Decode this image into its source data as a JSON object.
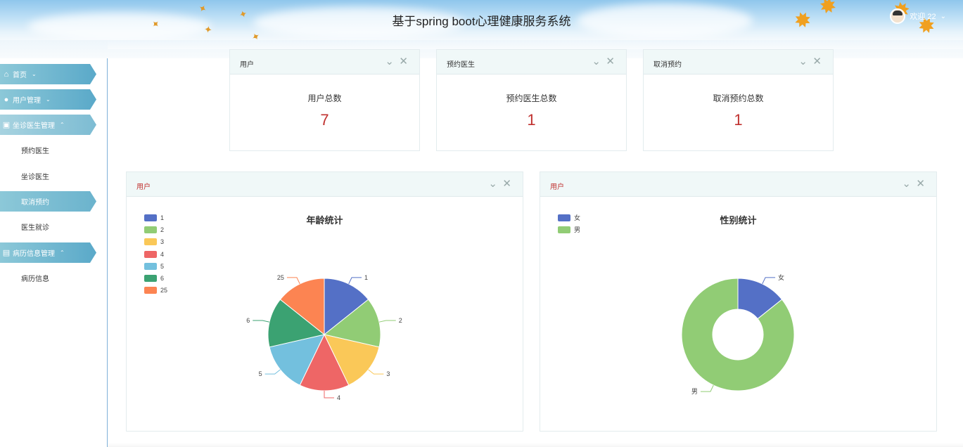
{
  "header": {
    "title": "基于spring boot心理健康服务系统",
    "welcome": "欢迎 22"
  },
  "sidebar": {
    "items": [
      {
        "label": "首页",
        "icon": "home-icon",
        "chevron": "⌄"
      },
      {
        "label": "用户管理",
        "icon": "user-icon",
        "chevron": "⌄"
      },
      {
        "label": "坐诊医生管理",
        "icon": "briefcase-icon",
        "chevron": "⌃"
      },
      {
        "label": "预约医生"
      },
      {
        "label": "坐诊医生"
      },
      {
        "label": "取消预约"
      },
      {
        "label": "医生就诊"
      },
      {
        "label": "病历信息管理",
        "icon": "book-icon",
        "chevron": "⌃"
      },
      {
        "label": "病历信息"
      }
    ]
  },
  "stats": [
    {
      "header": "用户",
      "label": "用户总数",
      "value": "7"
    },
    {
      "header": "预约医生",
      "label": "预约医生总数",
      "value": "1"
    },
    {
      "header": "取消预约",
      "label": "取消预约总数",
      "value": "1"
    }
  ],
  "colors": {
    "accent_red": "#c0312f",
    "sidebar_teal": "#5aa9c9"
  },
  "chart_data": [
    {
      "type": "pie",
      "panel_header": "用户",
      "title": "年龄统计",
      "legend_position": "top-left",
      "categories": [
        "1",
        "2",
        "3",
        "4",
        "5",
        "6",
        "25"
      ],
      "values": [
        1,
        1,
        1,
        1,
        1,
        1,
        1
      ],
      "colors": [
        "#5470c6",
        "#91cc75",
        "#fac858",
        "#ee6666",
        "#73c0de",
        "#3ba272",
        "#fc8452"
      ]
    },
    {
      "type": "pie",
      "variant": "donut",
      "panel_header": "用户",
      "title": "性别统计",
      "legend_position": "top-left",
      "categories": [
        "女",
        "男"
      ],
      "values": [
        1,
        6
      ],
      "colors": [
        "#5470c6",
        "#91cc75"
      ]
    }
  ]
}
